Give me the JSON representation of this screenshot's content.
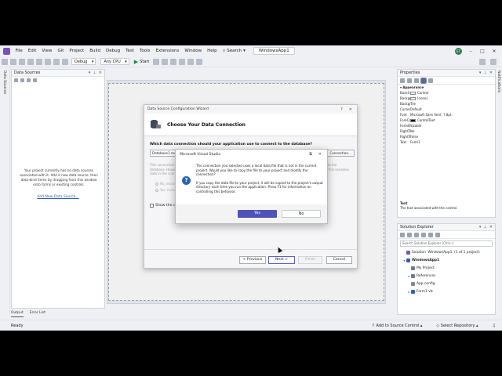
{
  "menu": {
    "items": [
      "File",
      "Edit",
      "View",
      "Git",
      "Project",
      "Build",
      "Debug",
      "Test",
      "Tools",
      "Extensions",
      "Window",
      "Help"
    ],
    "search_label": "Search",
    "solution_name": "WindowsApp1",
    "avatar_initials": "ET"
  },
  "toolbar": {
    "config": "Debug",
    "platform": "Any CPU",
    "start_label": "Start"
  },
  "left_strip": {
    "label": "Data Sources"
  },
  "right_strip": {
    "label": "Notifications"
  },
  "data_sources": {
    "title": "Data Sources",
    "message": "Your project currently has no data sources associated with it. Add a new data source, then data-bind items by dragging from this window onto forms or existing controls.",
    "link": "Add New Data Source..."
  },
  "bottom_tabs": [
    "Output",
    "Error List"
  ],
  "wizard": {
    "title": "Data Source Configuration Wizard",
    "help": "?",
    "close": "✕",
    "heading": "Choose Your Data Connection",
    "question": "Which data connection should your application use to connect to the database?",
    "selected_connection": "Database1.mdf",
    "new_connection_label": "Connection...",
    "faint_text": "This connection string appears to contain sensitive data (for example, a password), which is required to connect to the database. However, storing sensitive data in the connection string can be a security risk. Do you want to include this sensitive data in the connection string?",
    "radio_no": "No, exclude sensitive data from the connection string.",
    "radio_yes": "Yes, include sensitive data in the connection string.",
    "show_string_label": "Show the connection string that you will save in the application",
    "buttons": {
      "previous": "< Previous",
      "next": "Next >",
      "finish": "Finish",
      "cancel": "Cancel"
    }
  },
  "message_box": {
    "title": "Microsoft Visual Studio",
    "paragraph1": "The connection you selected uses a local data file that is not in the current project. Would you like to copy the file to your project and modify the connection?",
    "paragraph2": "If you copy the data file to your project, it will be copied to the project's output directory each time you run the application. Press F1 for information on controlling this behavior.",
    "yes_label": "Yes",
    "no_label": "No"
  },
  "properties": {
    "title": "Properties",
    "category": "Appearance",
    "rows": [
      {
        "name": "BackColor",
        "value": "Control",
        "swatch": "#f0f0f0"
      },
      {
        "name": "BackgroundImage",
        "value": "(none)",
        "swatch": "#ffffff"
      },
      {
        "name": "BackgroundImageLayout",
        "value": "Tile",
        "swatch": ""
      },
      {
        "name": "Cursor",
        "value": "Default",
        "swatch": ""
      },
      {
        "name": "Font",
        "value": "Microsoft Sans Serif, 7.8pt",
        "swatch": ""
      },
      {
        "name": "ForeColor",
        "value": "ControlText",
        "swatch": "#111111"
      },
      {
        "name": "FormBorderStyle",
        "value": "Sizable",
        "swatch": ""
      },
      {
        "name": "RightToLeft",
        "value": "No",
        "swatch": ""
      },
      {
        "name": "RightToLeftLayout",
        "value": "False",
        "swatch": ""
      },
      {
        "name": "Text",
        "value": "Form1",
        "swatch": ""
      }
    ],
    "desc_title": "Text",
    "desc_body": "The text associated with the control."
  },
  "solution_explorer": {
    "title": "Solution Explorer",
    "search_placeholder": "Search Solution Explorer (Ctrl+;)",
    "nodes": [
      {
        "label": "Solution 'WindowsApp1' (1 of 1 project)",
        "indent": 1,
        "expander": "",
        "color": "#7b4fc4",
        "bold": false
      },
      {
        "label": "WindowsApp1",
        "indent": 1,
        "expander": "▾",
        "color": "#2a63b3",
        "bold": true
      },
      {
        "label": "My Project",
        "indent": 2,
        "expander": "",
        "color": "#6b7a90",
        "bold": false
      },
      {
        "label": "References",
        "indent": 2,
        "expander": "▸",
        "color": "#6b7a90",
        "bold": false
      },
      {
        "label": "App.config",
        "indent": 2,
        "expander": "",
        "color": "#8a8a8a",
        "bold": false
      },
      {
        "label": "Form1.vb",
        "indent": 2,
        "expander": "▸",
        "color": "#2a63b3",
        "bold": false
      }
    ]
  },
  "status": {
    "left": "Ready",
    "add_source_control": "Add to Source Control",
    "select_repository": "Select Repository"
  }
}
